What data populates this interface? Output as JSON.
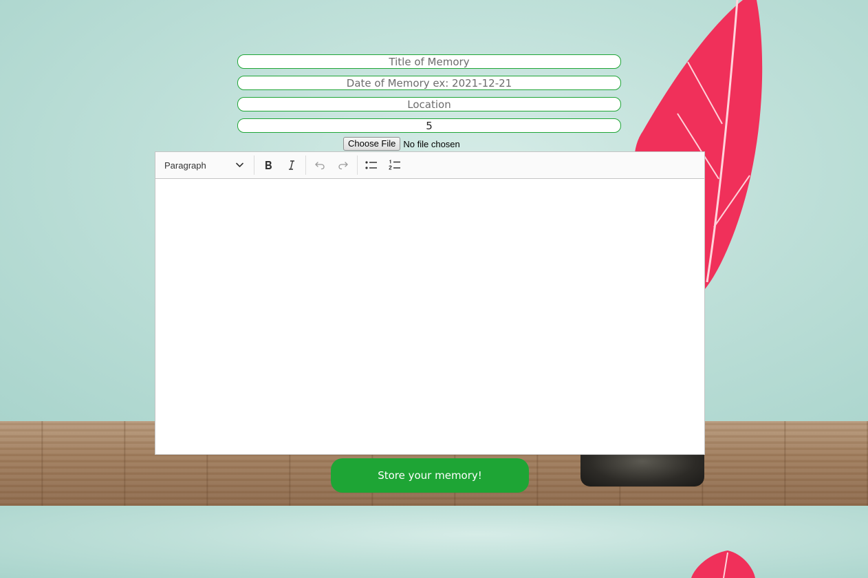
{
  "form": {
    "title_placeholder": "Title of Memory",
    "date_placeholder": "Date of Memory ex: 2021-12-21",
    "location_placeholder": "Location",
    "rating_value": "5",
    "file_button_label": "Choose File",
    "file_status": "No file chosen",
    "submit_label": "Store your memory!"
  },
  "editor": {
    "heading_select": "Paragraph",
    "toolbar_icons": [
      "bold-icon",
      "italic-icon",
      "undo-icon",
      "redo-icon",
      "bulleted-list-icon",
      "numbered-list-icon"
    ],
    "content": ""
  },
  "colors": {
    "accent": "#1ea535",
    "feather": "#f0305a",
    "wall": "#c5e5de"
  }
}
